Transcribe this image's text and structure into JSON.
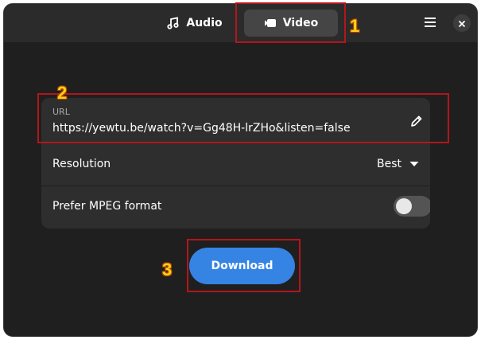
{
  "header": {
    "tabs": [
      {
        "label": "Audio",
        "icon": "music-note-icon",
        "selected": false
      },
      {
        "label": "Video",
        "icon": "video-camera-icon",
        "selected": true
      }
    ],
    "menu_icon": "hamburger-menu-icon",
    "close_icon": "close-icon"
  },
  "form": {
    "url": {
      "caption": "URL",
      "value": "https://yewtu.be/watch?v=Gg48H-lrZHo&listen=false",
      "edit_icon": "pencil-icon"
    },
    "resolution": {
      "label": "Resolution",
      "value": "Best",
      "dropdown_icon": "triangle-down-icon"
    },
    "mpeg": {
      "label": "Prefer MPEG format",
      "enabled": false
    }
  },
  "download": {
    "label": "Download"
  },
  "annotations": {
    "markers": [
      "1",
      "2",
      "3"
    ]
  },
  "colors": {
    "accent": "#3584e4",
    "highlight_box": "#b3161b",
    "marker_text": "#f7d117",
    "window_bg": "#1f1f1f",
    "card_bg": "#2e2e2e"
  }
}
